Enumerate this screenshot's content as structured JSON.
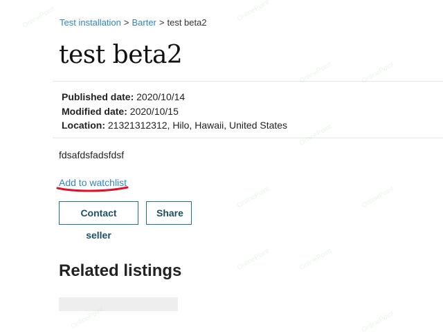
{
  "breadcrumb": {
    "items": [
      "Test installation",
      "Barter"
    ],
    "separator": ">",
    "current": "test beta2"
  },
  "listing": {
    "title": "test beta2",
    "published_label": "Published date:",
    "published_value": "2020/10/14",
    "modified_label": "Modified date:",
    "modified_value": "2020/10/15",
    "location_label": "Location:",
    "location_value": "21321312312, Hilo, Hawaii, United States",
    "description": "fdsafdsfadsfdsf"
  },
  "actions": {
    "watchlist_label": "Add to watchlist",
    "contact_label": "Contact seller",
    "share_label": "Share"
  },
  "related": {
    "heading": "Related listings"
  },
  "watermark": {
    "text": "OnlinePoint"
  },
  "colors": {
    "link": "#2e86c1",
    "button_border": "#1b6f8e",
    "annotation": "#e0102a"
  }
}
